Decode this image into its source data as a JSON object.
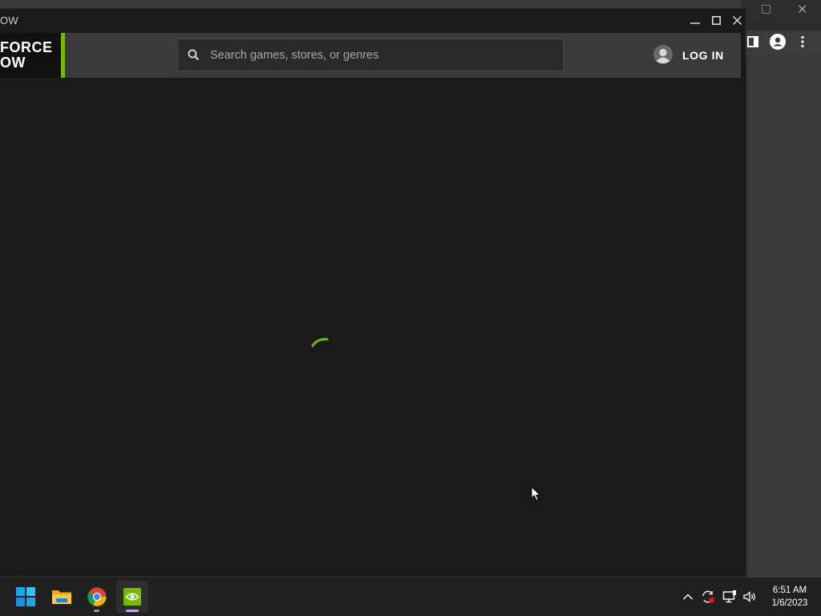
{
  "window": {
    "title_fragment": "OW",
    "minimize": "minimize",
    "maximize": "maximize",
    "close": "close"
  },
  "logo": {
    "line1": "FORCE",
    "line2": "OW",
    "accent": "#76b900"
  },
  "search": {
    "placeholder": "Search games, stores, or genres",
    "icon": "search-icon"
  },
  "account": {
    "login_label": "LOG IN",
    "icon": "user-avatar-icon"
  },
  "loading": {
    "icon": "spinner-icon",
    "color": "#76b900"
  },
  "taskbar": {
    "apps": [
      "start",
      "file-explorer",
      "chrome",
      "geforce-now"
    ],
    "tray_icons": [
      "chevron-up-icon",
      "sync-icon",
      "network-icon",
      "volume-icon"
    ],
    "time": "6:51 AM",
    "date": "1/6/2023"
  }
}
